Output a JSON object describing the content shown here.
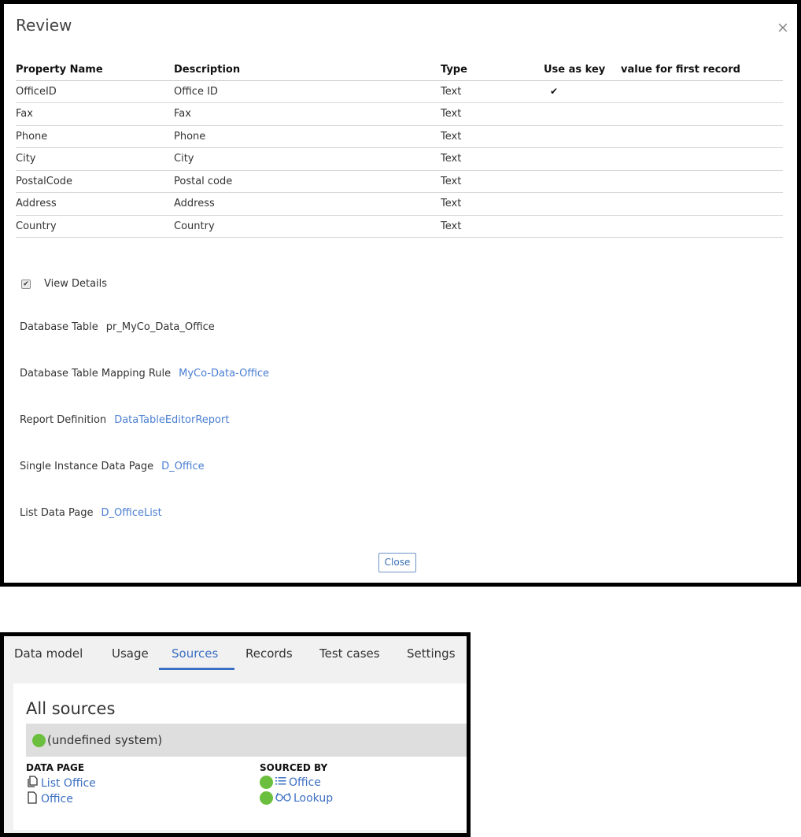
{
  "review": {
    "title": "Review",
    "close_glyph": "×",
    "columns": [
      "Property Name",
      "Description",
      "Type",
      "Use as key",
      "value for first record"
    ],
    "rows": [
      {
        "name": "OfficeID",
        "description": "Office ID",
        "type": "Text",
        "key": "✔",
        "first": ""
      },
      {
        "name": "Fax",
        "description": "Fax",
        "type": "Text",
        "key": "",
        "first": ""
      },
      {
        "name": "Phone",
        "description": "Phone",
        "type": "Text",
        "key": "",
        "first": ""
      },
      {
        "name": "City",
        "description": "City",
        "type": "Text",
        "key": "",
        "first": ""
      },
      {
        "name": "PostalCode",
        "description": "Postal code",
        "type": "Text",
        "key": "",
        "first": ""
      },
      {
        "name": "Address",
        "description": "Address",
        "type": "Text",
        "key": "",
        "first": ""
      },
      {
        "name": "Country",
        "description": "Country",
        "type": "Text",
        "key": "",
        "first": ""
      }
    ],
    "view_details": {
      "label": "View Details",
      "checked": true,
      "check_glyph": "✔"
    },
    "details": {
      "database_table_label": "Database Table",
      "database_table_value": "pr_MyCo_Data_Office",
      "mapping_rule_label": "Database Table Mapping Rule",
      "mapping_rule_link": "MyCo-Data-Office",
      "report_definition_label": "Report Definition",
      "report_definition_link": "DataTableEditorReport",
      "single_page_label": "Single Instance Data Page",
      "single_page_link": "D_Office",
      "list_page_label": "List Data Page",
      "list_page_link": "D_OfficeList"
    },
    "close_button": "Close"
  },
  "sources_panel": {
    "tabs": [
      "Data model",
      "Usage",
      "Sources",
      "Records",
      "Test cases",
      "Settings"
    ],
    "active_tab": "Sources",
    "heading": "All sources",
    "system_label": "(undefined system)",
    "col_data_page": "DATA PAGE",
    "col_sourced_by": "SOURCED BY",
    "data_pages": [
      "List Office",
      "Office"
    ],
    "sourced_by": [
      "Office",
      "Lookup"
    ],
    "status_color": "#6cbf3e",
    "link_color": "#3c6fc2",
    "icons": {
      "list_office": "pages-icon",
      "office": "page-icon",
      "office_source": "list-icon",
      "lookup_source": "glasses-icon"
    }
  }
}
